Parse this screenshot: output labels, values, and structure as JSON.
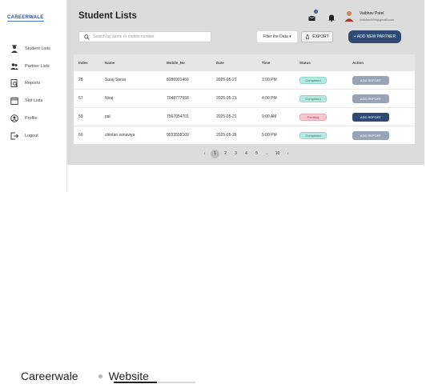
{
  "app": {
    "logo_text": "CAREERWALE"
  },
  "sidebar": {
    "items": [
      {
        "label": "Student Lists",
        "icon": "student-icon"
      },
      {
        "label": "Partner Lists",
        "icon": "partner-icon"
      },
      {
        "label": "Reports",
        "icon": "reports-icon"
      },
      {
        "label": "Slot Lists",
        "icon": "calendar-icon"
      },
      {
        "label": "Profile",
        "icon": "profile-icon"
      },
      {
        "label": "Logout",
        "icon": "logout-icon"
      }
    ]
  },
  "header": {
    "title": "Student Lists",
    "notifications_count": "0",
    "user_name": "Vaibhav Patel",
    "user_email": "Vaibhav999@gmail.com"
  },
  "toolbar": {
    "search_placeholder": "Search by name or mobile number",
    "filter_label": "Filter the Data ▾",
    "export_label": "EXPORT",
    "add_partner_label": "+ ADD NEW PARTNER"
  },
  "table": {
    "columns": [
      "Index",
      "Name",
      "Mobile_No",
      "Date",
      "Time",
      "Status",
      "Action"
    ],
    "rows": [
      {
        "index": "28",
        "name": "Suraj Sonar",
        "mobile": "8286901466",
        "date": "2025-05-21",
        "time": "1:00 PM",
        "status": "Completed",
        "action": "ADD REPORT"
      },
      {
        "index": "57",
        "name": "Niraj",
        "mobile": "7048777558",
        "date": "2025-05-21",
        "time": "4:00 PM",
        "status": "Completed",
        "action": "ADD REPORT"
      },
      {
        "index": "59",
        "name": "pal",
        "mobile": "7567054701",
        "date": "2025-05-21",
        "time": "9:00 AM",
        "status": "Pending",
        "action": "ADD REPORT"
      },
      {
        "index": "60",
        "name": "chintan sonaviya",
        "mobile": "9033558109",
        "date": "2025-05-26",
        "time": "5:00 PM",
        "status": "Completed",
        "action": "ADD REPORT"
      }
    ]
  },
  "pagination": {
    "prev": "‹",
    "pages": [
      "1",
      "2",
      "3",
      "4",
      "5",
      "...",
      "10"
    ],
    "current": "1",
    "next": "›"
  },
  "footer_tabs": {
    "first": "Careerwale",
    "second": "Website"
  },
  "colors": {
    "primary": "#2f4b73",
    "completed_bg": "#b9e8e0",
    "pending_bg": "#f6c9d2"
  }
}
